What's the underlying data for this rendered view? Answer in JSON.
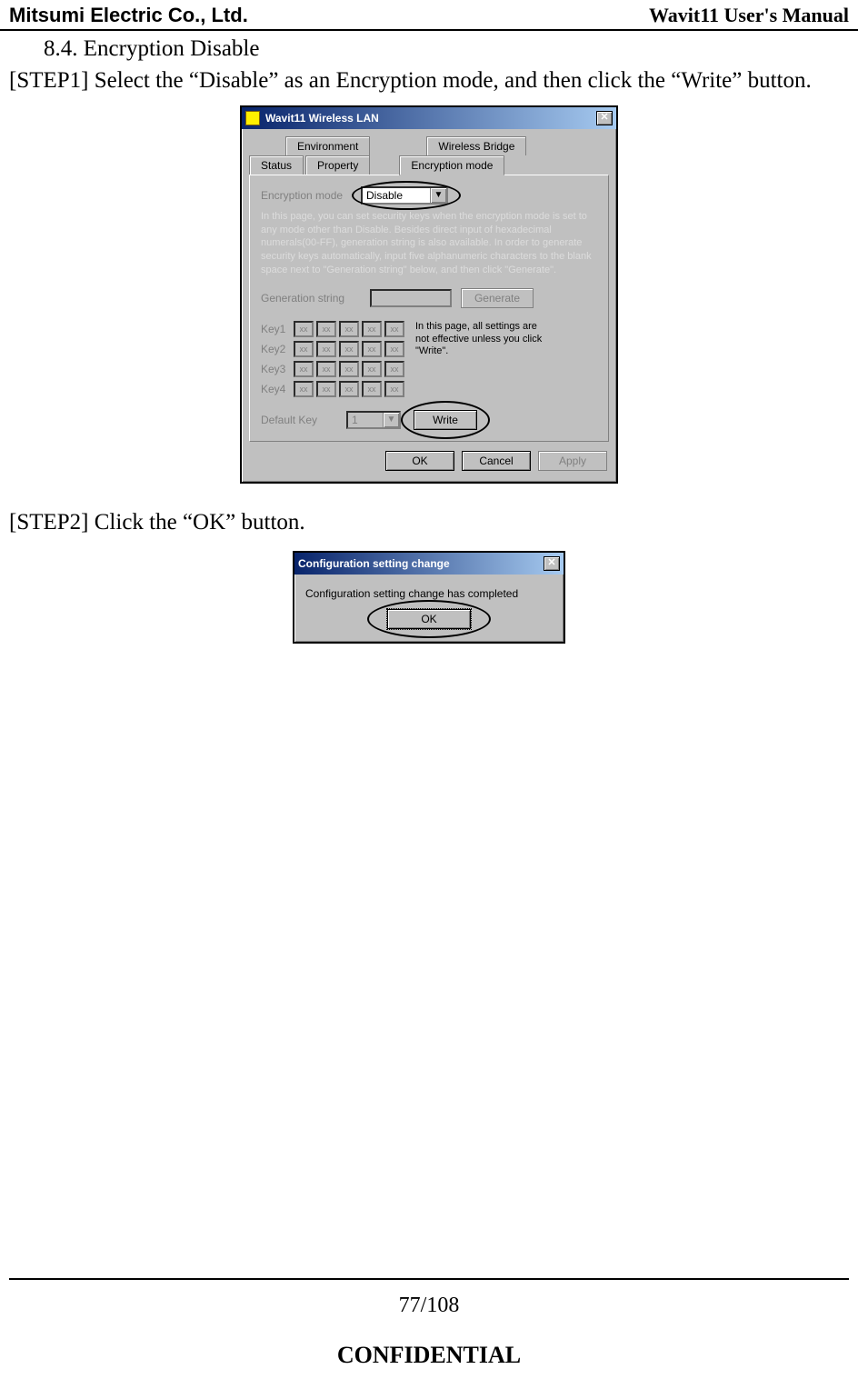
{
  "header": {
    "company": "Mitsumi Electric Co., Ltd.",
    "doc_title": "Wavit11 User's Manual"
  },
  "section": {
    "number": "8.4.",
    "title": "Encryption Disable"
  },
  "step1": "[STEP1] Select the “Disable” as an Encryption mode, and then click the “Write” button.",
  "step2": "[STEP2] Click the “OK” button.",
  "window1": {
    "title": "Wavit11 Wireless LAN",
    "tabs": {
      "row_top": [
        "Environment",
        "Wireless Bridge"
      ],
      "row_bottom": [
        "Status",
        "Property",
        "Encryption mode"
      ],
      "active": "Encryption mode"
    },
    "enc_mode_label": "Encryption mode",
    "enc_mode_value": "Disable",
    "help_text": "In this page, you can set security keys when the encryption mode is set to any mode other than Disable. Besides direct input of hexadecimal numerals(00-FF), generation string is also available. In order to generate security keys automatically, input five alphanumeric characters to the blank space next to \"Generation string\" below, and then click \"Generate\".",
    "generation_label": "Generation string",
    "generate_btn": "Generate",
    "key_labels": [
      "Key1",
      "Key2",
      "Key3",
      "Key4"
    ],
    "key_cell": "xx",
    "side_note": "In this page, all settings are not effective unless you click \"Write\".",
    "default_key_label": "Default Key",
    "default_key_value": "1",
    "write_btn": "Write",
    "ok_btn": "OK",
    "cancel_btn": "Cancel",
    "apply_btn": "Apply"
  },
  "window2": {
    "title": "Configuration setting change",
    "message": "Configuration setting change has completed",
    "ok_btn": "OK"
  },
  "footer": {
    "page": "77/108",
    "confidential": "CONFIDENTIAL"
  }
}
